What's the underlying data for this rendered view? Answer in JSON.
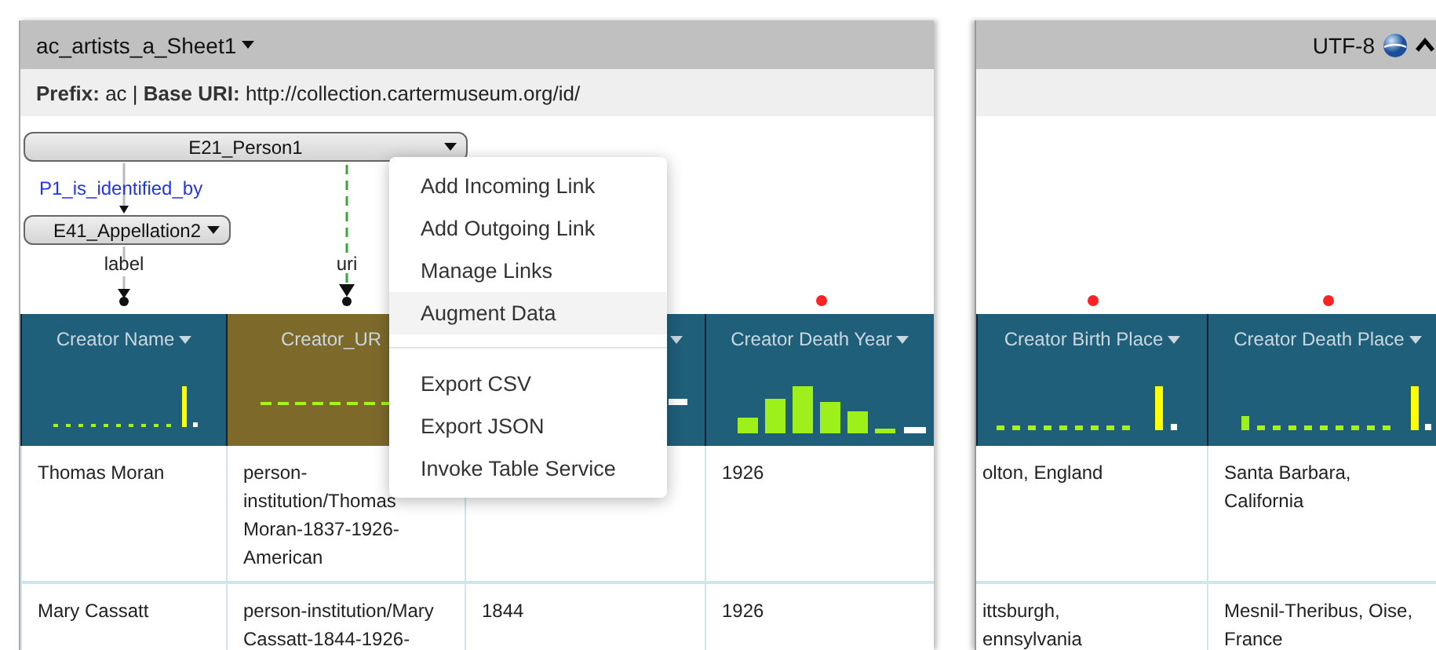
{
  "worksheet": {
    "title": "ac_artists_a_Sheet1",
    "encoding": "UTF-8",
    "info": "**Prefix:** ac | **Base URI:** http://collection.cartermuseum.org/id/"
  },
  "model": {
    "class_nodes": [
      {
        "label": "E21_Person1"
      },
      {
        "label": "E41_Appellation2"
      }
    ],
    "property_link": "P1_is_identified_by",
    "column_links": [
      {
        "label": "label",
        "kind": "solid"
      },
      {
        "label": "uri",
        "kind": "dashed"
      }
    ]
  },
  "context_menu": {
    "items": [
      {
        "kind": "item",
        "label": "Add Incoming Link",
        "highlighted": false
      },
      {
        "kind": "item",
        "label": "Add Outgoing Link",
        "highlighted": false
      },
      {
        "kind": "item",
        "label": "Manage Links",
        "highlighted": false
      },
      {
        "kind": "item",
        "label": "Augment Data",
        "highlighted": true
      },
      {
        "kind": "divider"
      },
      {
        "kind": "item",
        "label": "Export CSV",
        "highlighted": false
      },
      {
        "kind": "item",
        "label": "Export JSON",
        "highlighted": false
      },
      {
        "kind": "item",
        "label": "Invoke Table Service",
        "highlighted": false
      }
    ]
  },
  "left_table": {
    "columns": [
      {
        "label": "Creator Name",
        "dropdown": true,
        "selected": false,
        "unmapped": false
      },
      {
        "label": "Creator_UR",
        "dropdown": false,
        "selected": true,
        "unmapped": false
      },
      {
        "dropdown": true,
        "selected": false,
        "unmapped": false
      },
      {
        "label": "Creator Death Year",
        "dropdown": true,
        "selected": false,
        "unmapped": true
      }
    ],
    "rows": [
      {
        "cells": [
          "Thomas Moran",
          "person-institution/Thomas Moran-1837-1926-American",
          null,
          "1926"
        ]
      },
      {
        "cells": [
          "Mary Cassatt",
          "person-institution/Mary Cassatt-1844-1926-",
          "1844",
          "1926"
        ]
      }
    ]
  },
  "right_table": {
    "columns": [
      {
        "label": "Creator Birth Place",
        "dropdown": true,
        "selected": false,
        "unmapped": true
      },
      {
        "label": "Creator Death Place",
        "dropdown": true,
        "selected": false,
        "unmapped": true
      }
    ],
    "rows": [
      {
        "cells": [
          "olton, England",
          "Santa Barbara, California"
        ]
      },
      {
        "cells": [
          "ittsburgh, ennsylvania",
          "Mesnil-Theribus, Oise, France"
        ]
      }
    ]
  }
}
